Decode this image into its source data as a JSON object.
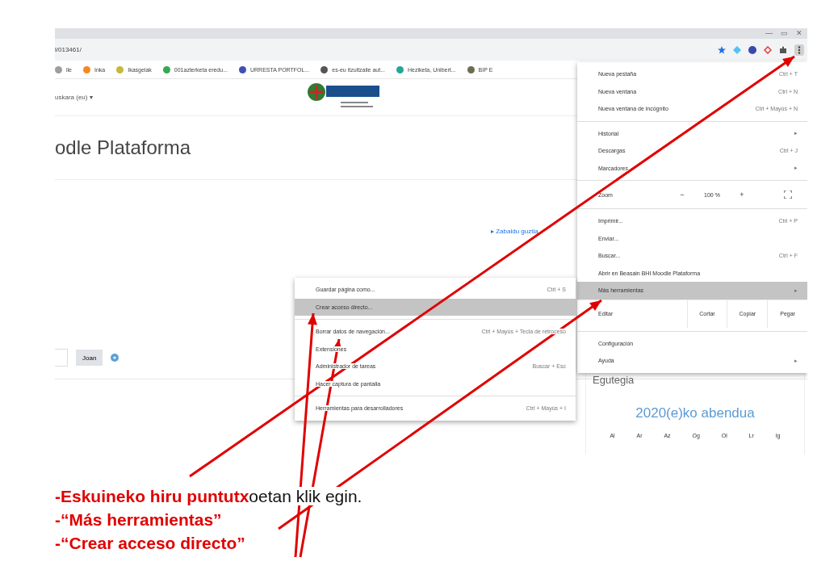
{
  "browser": {
    "window_controls": [
      "—",
      "▭",
      "✕"
    ],
    "address": "l/013461/",
    "bookmarks": [
      {
        "label": "lle",
        "color": "#9e9e9e"
      },
      {
        "label": "Inka",
        "color": "#f5891f"
      },
      {
        "label": "Ikasgelak",
        "color": "#c5b83a"
      },
      {
        "label": "001azterketa eredu...",
        "color": "#34a853"
      },
      {
        "label": "URRESTA PORTFOL...",
        "color": "#3f51b5"
      },
      {
        "label": "es-eu itzultzaile aut...",
        "color": "#555555"
      },
      {
        "label": "Heziketa, Unibert...",
        "color": "#26a69a"
      },
      {
        "label": "BIP E",
        "color": "#6d6d4f"
      }
    ]
  },
  "page": {
    "language": "uskara (eu) ▾",
    "site_title": "odle Plataforma",
    "expand_link": "▸ Zabaldu guztia",
    "search_button": "Joan",
    "calendar": {
      "title": "Egutegia",
      "month": "2020(e)ko abendua",
      "weekdays": [
        "Al",
        "Ar",
        "Az",
        "Og",
        "Ol",
        "Lr",
        "Ig"
      ]
    }
  },
  "chrome_menu": [
    {
      "kind": "item",
      "label": "Nueva pestaña",
      "shortcut": "Ctrl + T",
      "selected": false
    },
    {
      "kind": "item",
      "label": "Nueva ventana",
      "shortcut": "Ctrl + N",
      "selected": false
    },
    {
      "kind": "item",
      "label": "Nueva ventana de incógnito",
      "shortcut": "Ctrl + Mayús + N",
      "selected": false
    },
    {
      "kind": "separator"
    },
    {
      "kind": "item",
      "label": "Historial",
      "shortcut": "▸",
      "selected": false
    },
    {
      "kind": "item",
      "label": "Descargas",
      "shortcut": "Ctrl + J",
      "selected": false
    },
    {
      "kind": "item",
      "label": "Marcadores",
      "shortcut": "▸",
      "selected": false
    },
    {
      "kind": "separator"
    },
    {
      "kind": "zoom",
      "label": "Zoom",
      "minus": "−",
      "value": "100 %",
      "plus": "+"
    },
    {
      "kind": "separator"
    },
    {
      "kind": "item",
      "label": "Imprimir...",
      "shortcut": "Ctrl + P",
      "selected": false
    },
    {
      "kind": "item",
      "label": "Enviar...",
      "selected": false
    },
    {
      "kind": "item",
      "label": "Buscar...",
      "shortcut": "Ctrl + F",
      "selected": false
    },
    {
      "kind": "item",
      "label": "Abrir en Beasain BHI Moodle Plataforma",
      "selected": false
    },
    {
      "kind": "item",
      "label": "Más herramientas",
      "shortcut": "▸",
      "selected": true
    },
    {
      "kind": "edit",
      "label": "Editar",
      "buttons": [
        "Cortar",
        "Copiar",
        "Pegar"
      ]
    },
    {
      "kind": "separator"
    },
    {
      "kind": "item",
      "label": "Configuración",
      "selected": false
    },
    {
      "kind": "item",
      "label": "Ayuda",
      "shortcut": "▸",
      "selected": false
    }
  ],
  "submenu": [
    {
      "kind": "item",
      "label": "Guardar página como...",
      "shortcut": "Ctrl + S",
      "selected": false
    },
    {
      "kind": "item",
      "label": "Crear acceso directo...",
      "selected": true
    },
    {
      "kind": "separator"
    },
    {
      "kind": "item",
      "label": "Borrar datos de navegación...",
      "shortcut": "Ctrl + Mayús + Tecla de retroceso",
      "selected": false
    },
    {
      "kind": "item",
      "label": "Extensiones",
      "selected": false
    },
    {
      "kind": "item",
      "label": "Administrador de tareas",
      "shortcut": "Buscar + Esc",
      "selected": false
    },
    {
      "kind": "item",
      "label": "Hacer captura de pantalla",
      "selected": false
    },
    {
      "kind": "separator"
    },
    {
      "kind": "item",
      "label": "Herramientas para desarrolladores",
      "shortcut": "Ctrl + Mayús + I",
      "selected": false
    }
  ],
  "instructions": [
    {
      "segments": [
        {
          "text": "-Eskuineko hiru puntutx",
          "highlight": true
        },
        {
          "text": "oetan klik egin.",
          "highlight": false
        }
      ]
    },
    {
      "segments": [
        {
          "text": "-“Más herramientas”",
          "highlight": true
        }
      ]
    },
    {
      "segments": [
        {
          "text": "-“Crear acceso directo”",
          "highlight": true
        }
      ]
    }
  ]
}
